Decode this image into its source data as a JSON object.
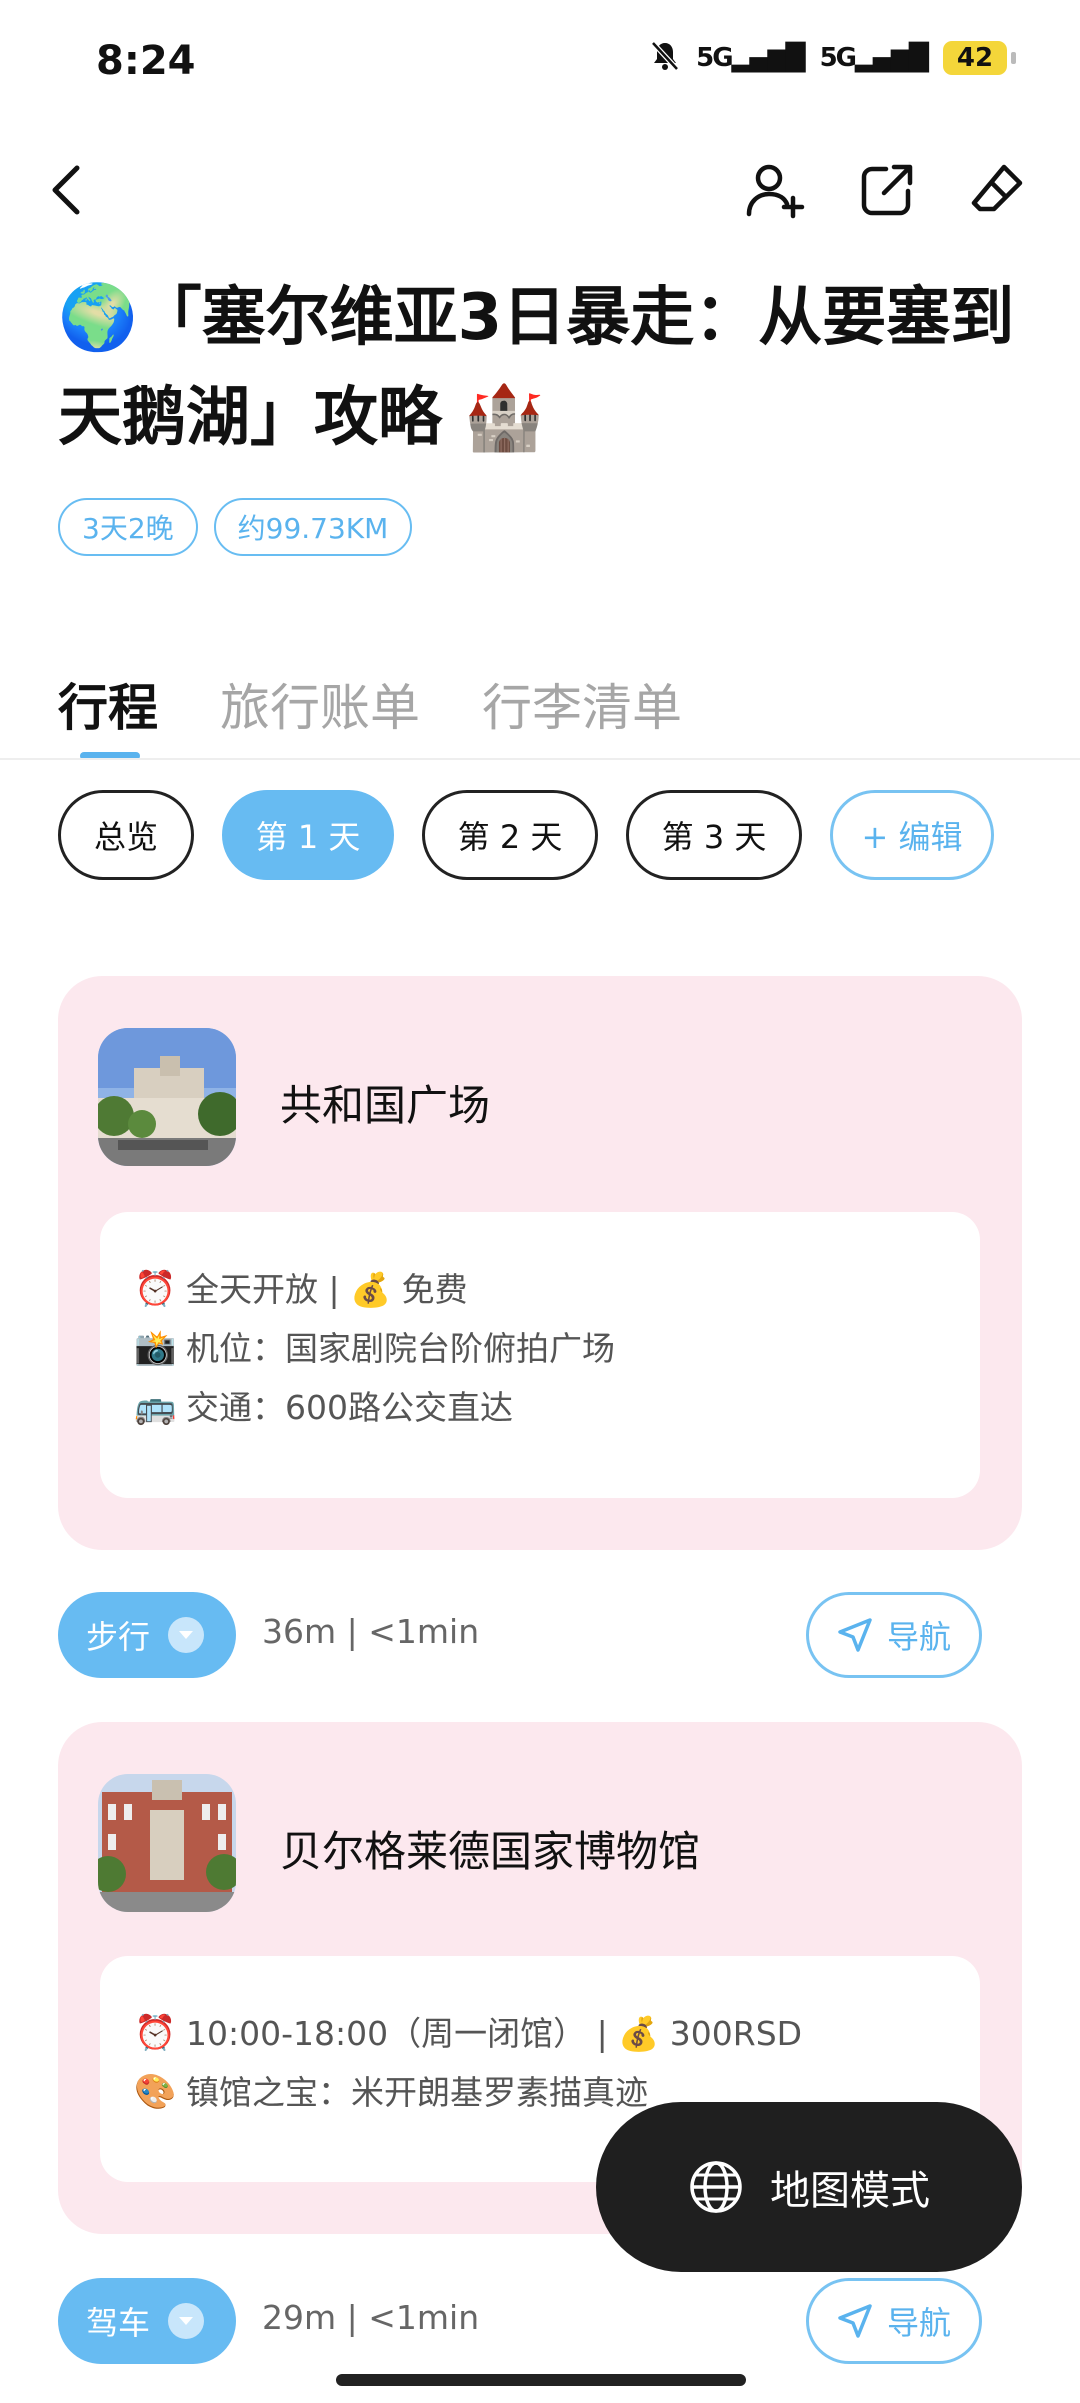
{
  "status_bar": {
    "time": "8:24",
    "signal1": "5G",
    "signal2": "5G",
    "battery": "42"
  },
  "trip": {
    "title": "🌍「塞尔维亚3日暴走：从要塞到天鹅湖」攻略 🏰",
    "tags": [
      "3天2晚",
      "约99.73KM"
    ]
  },
  "tabs": [
    {
      "label": "行程",
      "active": true
    },
    {
      "label": "旅行账单",
      "active": false
    },
    {
      "label": "行李清单",
      "active": false
    }
  ],
  "days": [
    {
      "label": "总览"
    },
    {
      "label": "第 1 天"
    },
    {
      "label": "第 2 天"
    },
    {
      "label": "第 3 天"
    },
    {
      "label": "+ 编辑"
    }
  ],
  "places": [
    {
      "name": "共和国广场",
      "lines": [
        {
          "icon": "⏰",
          "text": "全天开放 | 💰 免费"
        },
        {
          "icon": "📸",
          "text": "机位：国家剧院台阶俯拍广场"
        },
        {
          "icon": "🚌",
          "text": "交通：600路公交直达"
        }
      ]
    },
    {
      "name": "贝尔格莱德国家博物馆",
      "lines": [
        {
          "icon": "⏰",
          "text": "10:00-18:00（周一闭馆） | 💰 300RSD"
        },
        {
          "icon": "🎨",
          "text": "镇馆之宝：米开朗基罗素描真迹"
        }
      ]
    }
  ],
  "transports": [
    {
      "mode": "步行",
      "distance": "36m",
      "time": "<1min",
      "nav_label": "导航"
    },
    {
      "mode": "驾车",
      "distance": "29m",
      "time": "<1min",
      "nav_label": "导航"
    }
  ],
  "map_mode_label": "地图模式",
  "colors": {
    "accent": "#67bbf2",
    "card_bg": "#fce8ee",
    "map_button_bg": "#1f1f1f"
  }
}
